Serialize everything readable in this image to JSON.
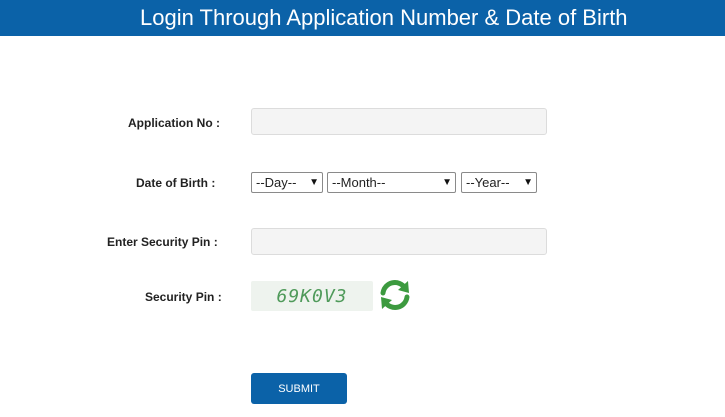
{
  "header": {
    "title": "Login Through Application Number & Date of Birth"
  },
  "form": {
    "application_label": "Application No :",
    "application_value": "",
    "dob_label": "Date of Birth :",
    "day_selected": "--Day--",
    "month_selected": "--Month--",
    "year_selected": "--Year--",
    "enter_pin_label": "Enter Security Pin :",
    "enter_pin_value": "",
    "security_pin_label": "Security Pin :",
    "captcha_text": "69K0V3",
    "submit_label": "SUBMIT"
  },
  "icons": {
    "refresh": "refresh-icon",
    "dropdown": "chevron-down-icon"
  },
  "colors": {
    "header_bg": "#0b62a8",
    "button_bg": "#0b62a8",
    "captcha_text": "#4f9a5a",
    "refresh_green": "#3c9a3f"
  }
}
